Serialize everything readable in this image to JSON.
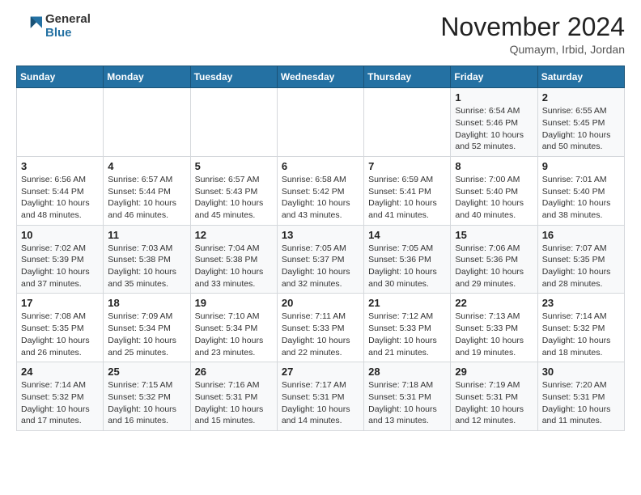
{
  "header": {
    "logo": {
      "general": "General",
      "blue": "Blue"
    },
    "title": "November 2024",
    "location": "Qumaym, Irbid, Jordan"
  },
  "days_of_week": [
    "Sunday",
    "Monday",
    "Tuesday",
    "Wednesday",
    "Thursday",
    "Friday",
    "Saturday"
  ],
  "weeks": [
    [
      {
        "day": "",
        "info": ""
      },
      {
        "day": "",
        "info": ""
      },
      {
        "day": "",
        "info": ""
      },
      {
        "day": "",
        "info": ""
      },
      {
        "day": "",
        "info": ""
      },
      {
        "day": "1",
        "info": "Sunrise: 6:54 AM\nSunset: 5:46 PM\nDaylight: 10 hours and 52 minutes."
      },
      {
        "day": "2",
        "info": "Sunrise: 6:55 AM\nSunset: 5:45 PM\nDaylight: 10 hours and 50 minutes."
      }
    ],
    [
      {
        "day": "3",
        "info": "Sunrise: 6:56 AM\nSunset: 5:44 PM\nDaylight: 10 hours and 48 minutes."
      },
      {
        "day": "4",
        "info": "Sunrise: 6:57 AM\nSunset: 5:44 PM\nDaylight: 10 hours and 46 minutes."
      },
      {
        "day": "5",
        "info": "Sunrise: 6:57 AM\nSunset: 5:43 PM\nDaylight: 10 hours and 45 minutes."
      },
      {
        "day": "6",
        "info": "Sunrise: 6:58 AM\nSunset: 5:42 PM\nDaylight: 10 hours and 43 minutes."
      },
      {
        "day": "7",
        "info": "Sunrise: 6:59 AM\nSunset: 5:41 PM\nDaylight: 10 hours and 41 minutes."
      },
      {
        "day": "8",
        "info": "Sunrise: 7:00 AM\nSunset: 5:40 PM\nDaylight: 10 hours and 40 minutes."
      },
      {
        "day": "9",
        "info": "Sunrise: 7:01 AM\nSunset: 5:40 PM\nDaylight: 10 hours and 38 minutes."
      }
    ],
    [
      {
        "day": "10",
        "info": "Sunrise: 7:02 AM\nSunset: 5:39 PM\nDaylight: 10 hours and 37 minutes."
      },
      {
        "day": "11",
        "info": "Sunrise: 7:03 AM\nSunset: 5:38 PM\nDaylight: 10 hours and 35 minutes."
      },
      {
        "day": "12",
        "info": "Sunrise: 7:04 AM\nSunset: 5:38 PM\nDaylight: 10 hours and 33 minutes."
      },
      {
        "day": "13",
        "info": "Sunrise: 7:05 AM\nSunset: 5:37 PM\nDaylight: 10 hours and 32 minutes."
      },
      {
        "day": "14",
        "info": "Sunrise: 7:05 AM\nSunset: 5:36 PM\nDaylight: 10 hours and 30 minutes."
      },
      {
        "day": "15",
        "info": "Sunrise: 7:06 AM\nSunset: 5:36 PM\nDaylight: 10 hours and 29 minutes."
      },
      {
        "day": "16",
        "info": "Sunrise: 7:07 AM\nSunset: 5:35 PM\nDaylight: 10 hours and 28 minutes."
      }
    ],
    [
      {
        "day": "17",
        "info": "Sunrise: 7:08 AM\nSunset: 5:35 PM\nDaylight: 10 hours and 26 minutes."
      },
      {
        "day": "18",
        "info": "Sunrise: 7:09 AM\nSunset: 5:34 PM\nDaylight: 10 hours and 25 minutes."
      },
      {
        "day": "19",
        "info": "Sunrise: 7:10 AM\nSunset: 5:34 PM\nDaylight: 10 hours and 23 minutes."
      },
      {
        "day": "20",
        "info": "Sunrise: 7:11 AM\nSunset: 5:33 PM\nDaylight: 10 hours and 22 minutes."
      },
      {
        "day": "21",
        "info": "Sunrise: 7:12 AM\nSunset: 5:33 PM\nDaylight: 10 hours and 21 minutes."
      },
      {
        "day": "22",
        "info": "Sunrise: 7:13 AM\nSunset: 5:33 PM\nDaylight: 10 hours and 19 minutes."
      },
      {
        "day": "23",
        "info": "Sunrise: 7:14 AM\nSunset: 5:32 PM\nDaylight: 10 hours and 18 minutes."
      }
    ],
    [
      {
        "day": "24",
        "info": "Sunrise: 7:14 AM\nSunset: 5:32 PM\nDaylight: 10 hours and 17 minutes."
      },
      {
        "day": "25",
        "info": "Sunrise: 7:15 AM\nSunset: 5:32 PM\nDaylight: 10 hours and 16 minutes."
      },
      {
        "day": "26",
        "info": "Sunrise: 7:16 AM\nSunset: 5:31 PM\nDaylight: 10 hours and 15 minutes."
      },
      {
        "day": "27",
        "info": "Sunrise: 7:17 AM\nSunset: 5:31 PM\nDaylight: 10 hours and 14 minutes."
      },
      {
        "day": "28",
        "info": "Sunrise: 7:18 AM\nSunset: 5:31 PM\nDaylight: 10 hours and 13 minutes."
      },
      {
        "day": "29",
        "info": "Sunrise: 7:19 AM\nSunset: 5:31 PM\nDaylight: 10 hours and 12 minutes."
      },
      {
        "day": "30",
        "info": "Sunrise: 7:20 AM\nSunset: 5:31 PM\nDaylight: 10 hours and 11 minutes."
      }
    ]
  ]
}
